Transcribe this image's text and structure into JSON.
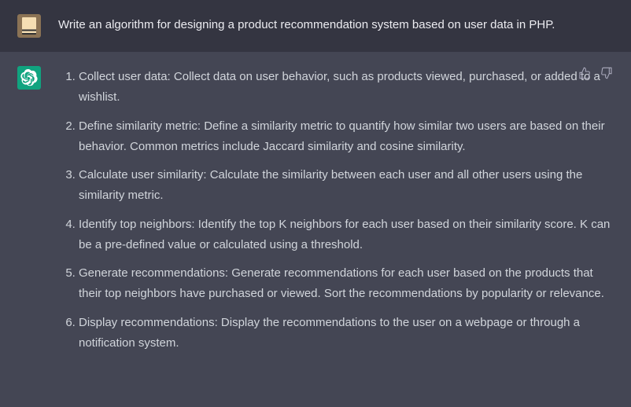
{
  "user": {
    "prompt": "Write an algorithm for designing a product recommendation system based on user data in PHP."
  },
  "assistant": {
    "steps": [
      "Collect user data: Collect data on user behavior, such as products viewed, purchased, or added to a wishlist.",
      "Define similarity metric: Define a similarity metric to quantify how similar two users are based on their behavior. Common metrics include Jaccard similarity and cosine similarity.",
      "Calculate user similarity: Calculate the similarity between each user and all other users using the similarity metric.",
      "Identify top neighbors: Identify the top K neighbors for each user based on their similarity score. K can be a pre-defined value or calculated using a threshold.",
      "Generate recommendations: Generate recommendations for each user based on the products that their top neighbors have purchased or viewed. Sort the recommendations by popularity or relevance.",
      "Display recommendations: Display the recommendations to the user on a webpage or through a notification system."
    ]
  }
}
